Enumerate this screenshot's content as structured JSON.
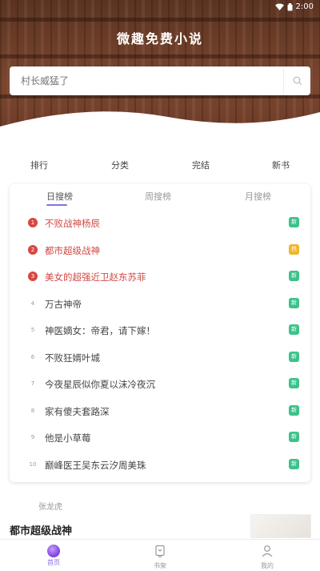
{
  "status": {
    "time": "2:00"
  },
  "app": {
    "title": "微趣免费小说"
  },
  "search": {
    "placeholder": "村长威猛了"
  },
  "categories": [
    "排行",
    "分类",
    "完结",
    "新书"
  ],
  "ranking": {
    "tabs": [
      "日搜榜",
      "周搜榜",
      "月搜榜"
    ],
    "active_tab": 0,
    "items": [
      {
        "rank": "1",
        "title": "不败战神杨辰",
        "top": true,
        "tag": "新",
        "tag_type": "new"
      },
      {
        "rank": "2",
        "title": "都市超级战神",
        "top": true,
        "tag": "热",
        "tag_type": "hot"
      },
      {
        "rank": "3",
        "title": "美女的超强近卫赵东苏菲",
        "top": true,
        "tag": "新",
        "tag_type": "new"
      },
      {
        "rank": "4",
        "title": "万古神帝",
        "top": false,
        "tag": "新",
        "tag_type": "new"
      },
      {
        "rank": "5",
        "title": "神医嫡女：帝君，请下嫁！",
        "top": false,
        "tag": "新",
        "tag_type": "new"
      },
      {
        "rank": "6",
        "title": "不败狂婿叶城",
        "top": false,
        "tag": "新",
        "tag_type": "new"
      },
      {
        "rank": "7",
        "title": "今夜星辰似你夏以沫冷夜沉",
        "top": false,
        "tag": "新",
        "tag_type": "new"
      },
      {
        "rank": "8",
        "title": "家有傻夫套路深",
        "top": false,
        "tag": "新",
        "tag_type": "new"
      },
      {
        "rank": "9",
        "title": "他是小草莓",
        "top": false,
        "tag": "新",
        "tag_type": "new"
      },
      {
        "rank": "10",
        "title": "巅峰医王吴东云汐周美珠",
        "top": false,
        "tag": "新",
        "tag_type": "new"
      }
    ]
  },
  "feature": {
    "author": "张龙虎",
    "book_title": "都市超级战神"
  },
  "tabbar": [
    "首页",
    "书架",
    "我的"
  ],
  "colors": {
    "accent": "#8a6fe0",
    "rank_top": "#d9473f",
    "tag_new": "#3cc28a",
    "tag_hot": "#f0b52c",
    "header_brown": "#6b3d28"
  }
}
